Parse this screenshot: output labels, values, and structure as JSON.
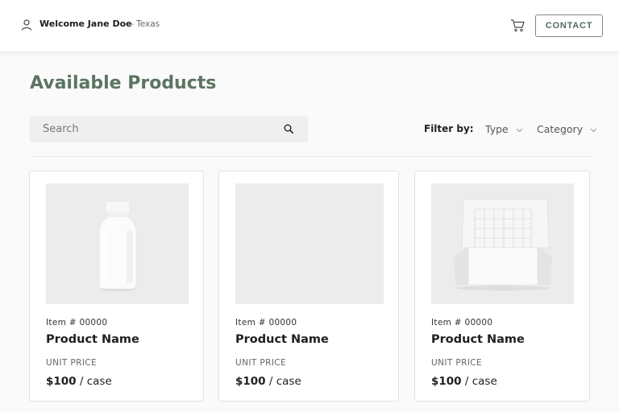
{
  "header": {
    "welcome_text": "Welcome Jane Doe",
    "region_text": "- Texas",
    "icons": {
      "user": "user-icon",
      "cart": "cart-icon"
    },
    "contact_label": "CONTACT"
  },
  "main": {
    "title": "Available Products",
    "search": {
      "placeholder": "Search",
      "value": ""
    },
    "filter": {
      "label": "Filter by:",
      "type_label": "Type",
      "category_label": "Category"
    }
  },
  "products": [
    {
      "item_no": "Item # 00000",
      "name": "Product Name",
      "unit_label": "UNIT PRICE",
      "price": "$100",
      "unit": "/ case",
      "image": "white-bottle"
    },
    {
      "item_no": "Item # 00000",
      "name": "Product Name",
      "unit_label": "UNIT PRICE",
      "price": "$100",
      "unit": "/ case",
      "image": "blank"
    },
    {
      "item_no": "Item # 00000",
      "name": "Product Name",
      "unit_label": "UNIT PRICE",
      "price": "$100",
      "unit": "/ case",
      "image": "open-white-box"
    }
  ],
  "colors": {
    "accent_green": "#5c7462",
    "button_border": "#7e8a82",
    "card_border": "#e3e3e3",
    "image_bg": "#ececec"
  }
}
